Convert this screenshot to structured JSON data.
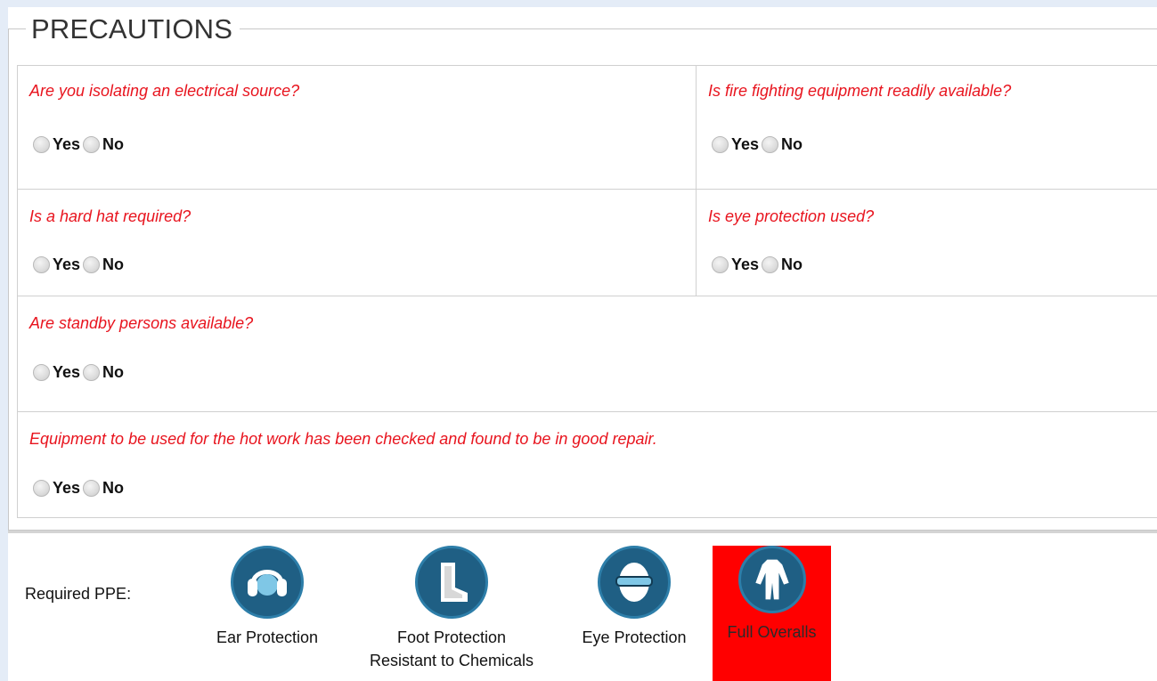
{
  "section": {
    "title": "PRECAUTIONS"
  },
  "questions": [
    {
      "text": "Are you isolating an electrical source?",
      "yes": "Yes",
      "no": "No"
    },
    {
      "text": "Is fire fighting equipment readily available?",
      "yes": "Yes",
      "no": "No"
    },
    {
      "text": "Is a hard hat required?",
      "yes": "Yes",
      "no": "No"
    },
    {
      "text": "Is eye protection used?",
      "yes": "Yes",
      "no": "No"
    },
    {
      "text": "Are standby persons available?",
      "yes": "Yes",
      "no": "No"
    },
    {
      "text": "Equipment to be used for the hot work has been checked and found to be in good repair.",
      "yes": "Yes",
      "no": "No"
    }
  ],
  "ppe": {
    "label": "Required PPE:",
    "items": [
      {
        "label": "Ear Protection",
        "icon": "ear-protection-icon",
        "selected": false
      },
      {
        "label": "Foot Protection\nResistant to Chemicals",
        "icon": "foot-protection-icon",
        "selected": false
      },
      {
        "label": "Eye Protection",
        "icon": "eye-protection-icon",
        "selected": false
      },
      {
        "label": "Full Overalls",
        "icon": "full-overalls-icon",
        "selected": true
      }
    ]
  },
  "colors": {
    "question_text": "#e8141e",
    "icon_circle": "#1f5f84",
    "selected_background": "#ff0000"
  }
}
